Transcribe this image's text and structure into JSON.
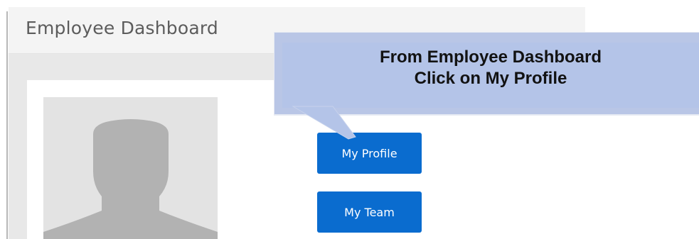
{
  "page": {
    "title": "Employee Dashboard"
  },
  "buttons": {
    "my_profile": "My Profile",
    "my_team": "My Team"
  },
  "callout": {
    "line1": "From Employee Dashboard",
    "line2": "Click on My Profile"
  },
  "colors": {
    "button": "#0a6ccf",
    "callout": "#b4c4e8",
    "header_bg": "#f4f4f4",
    "avatar_bg": "#e3e3e3",
    "avatar_silhouette": "#b2b2b2"
  },
  "icons": {
    "avatar": "user-silhouette"
  }
}
